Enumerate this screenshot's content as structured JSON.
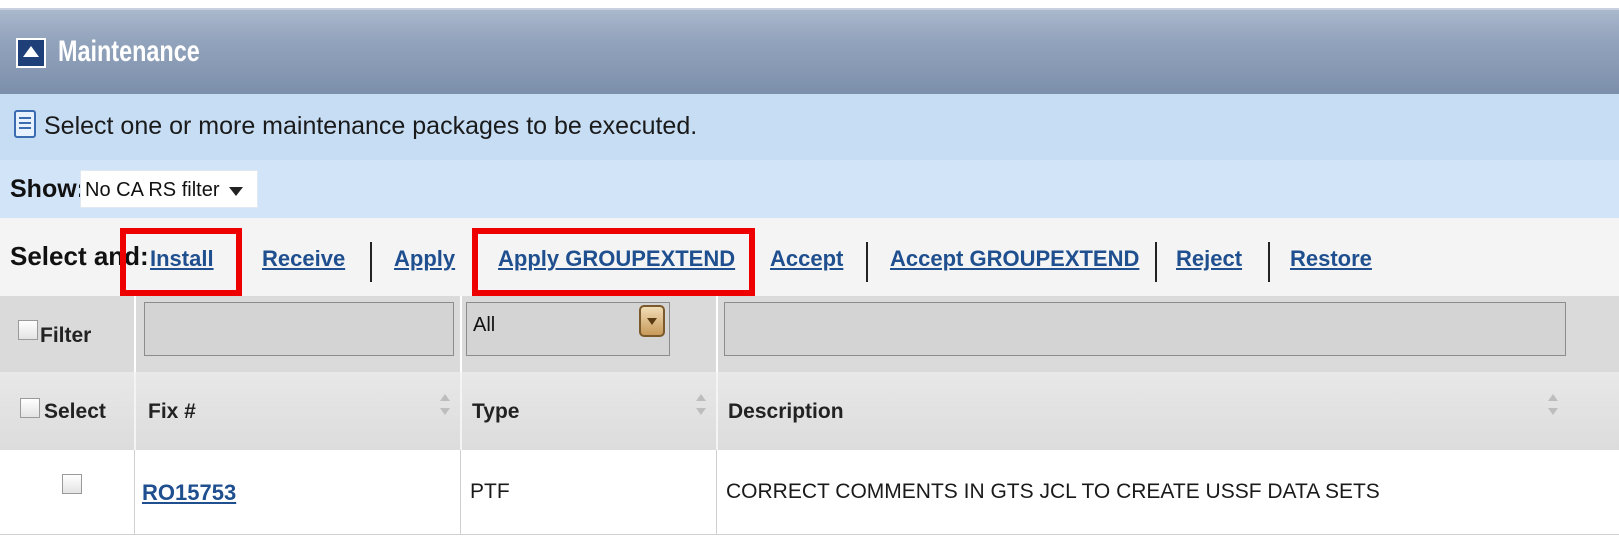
{
  "panel": {
    "title": "Maintenance",
    "info_text": "Select one or more maintenance packages to be executed."
  },
  "show": {
    "label": "Show:",
    "selected": "No CA RS filter"
  },
  "actions": {
    "label": "Select and:",
    "items": [
      "Install",
      "Receive",
      "Apply",
      "Apply GROUPEXTEND",
      "Accept",
      "Accept GROUPEXTEND",
      "Reject",
      "Restore"
    ],
    "highlighted": [
      "Install",
      "Apply GROUPEXTEND"
    ],
    "highlight_color": "#ee0000"
  },
  "filter": {
    "label": "Filter",
    "fix_value": "",
    "type_selected": "All",
    "description_value": ""
  },
  "table": {
    "columns": [
      "Select",
      "Fix #",
      "Type",
      "Description"
    ],
    "rows": [
      {
        "fix": "RO15753",
        "type": "PTF",
        "description": "CORRECT COMMENTS IN GTS JCL TO CREATE USSF DATA SETS"
      }
    ]
  },
  "colors": {
    "title_bar": "#8a9bb6",
    "info_background": "#c6ddf4",
    "link": "#1f4f8f"
  }
}
